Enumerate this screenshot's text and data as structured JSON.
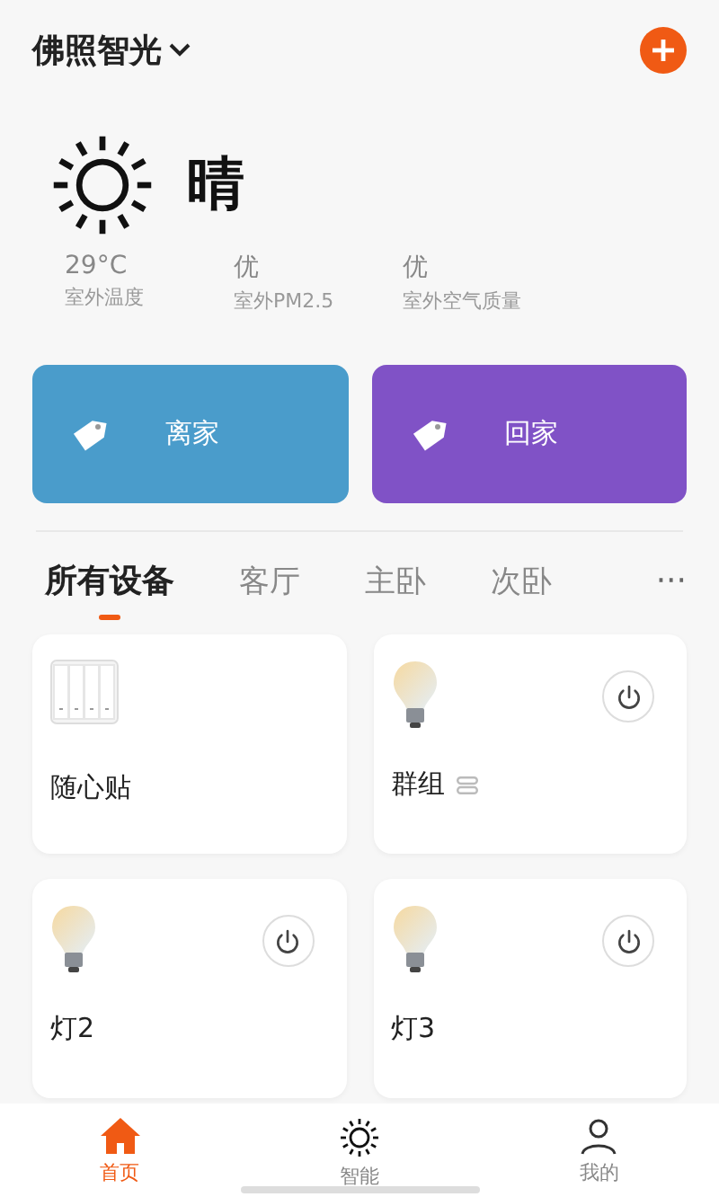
{
  "header": {
    "home_name": "佛照智光"
  },
  "weather": {
    "condition": "晴",
    "stats": [
      {
        "value": "29°C",
        "label": "室外温度"
      },
      {
        "value": "优",
        "label": "室外PM2.5"
      },
      {
        "value": "优",
        "label": "室外空气质量"
      }
    ]
  },
  "scenes": [
    {
      "label": "离家",
      "color": "#4a9ccb"
    },
    {
      "label": "回家",
      "color": "#8052c6"
    }
  ],
  "tabs": [
    {
      "label": "所有设备",
      "selected": true
    },
    {
      "label": "客厅",
      "selected": false
    },
    {
      "label": "主卧",
      "selected": false
    },
    {
      "label": "次卧",
      "selected": false
    }
  ],
  "more": "···",
  "devices": [
    {
      "kind": "switch",
      "name": "随心贴",
      "group": false
    },
    {
      "kind": "bulb",
      "name": "群组",
      "group": true
    },
    {
      "kind": "bulb",
      "name": "灯2",
      "group": false
    },
    {
      "kind": "bulb",
      "name": "灯3",
      "group": false
    }
  ],
  "nav": [
    {
      "kind": "home",
      "label": "首页",
      "selected": true
    },
    {
      "kind": "smart",
      "label": "智能",
      "selected": false
    },
    {
      "kind": "me",
      "label": "我的",
      "selected": false
    }
  ]
}
